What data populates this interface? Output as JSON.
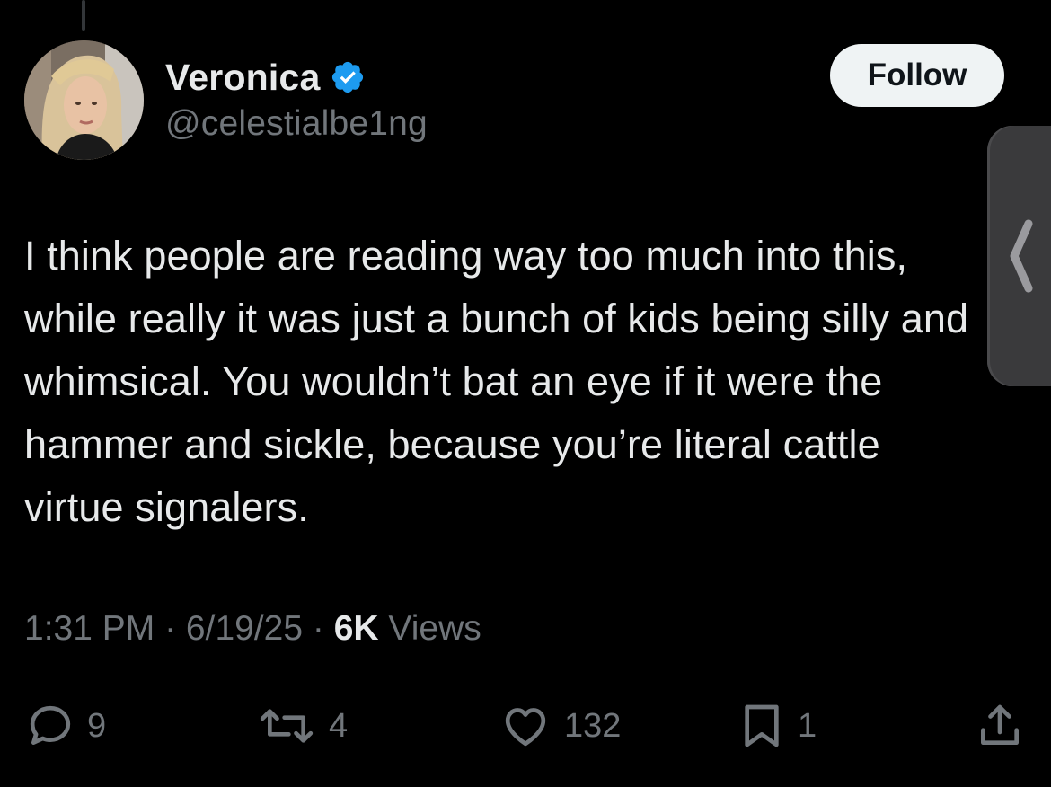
{
  "author": {
    "display_name": "Veronica",
    "handle": "@celestialbe1ng",
    "verified": true
  },
  "follow_button": {
    "label": "Follow"
  },
  "tweet": {
    "text": "I think people are reading way too much into this, while really it was just a bunch of kids being silly and whimsical. You wouldn’t bat an eye if it were the hammer and sickle, because you’re literal cattle virtue signalers.",
    "time": "1:31 PM",
    "date": "6/19/25",
    "separator": " · ",
    "views_count": "6K",
    "views_label": " Views"
  },
  "actions": {
    "replies": "9",
    "reposts": "4",
    "likes": "132",
    "bookmarks": "1"
  },
  "icons": {
    "reply": "reply-icon",
    "repost": "repost-icon",
    "like": "heart-icon",
    "bookmark": "bookmark-icon",
    "share": "share-icon",
    "verified": "verified-badge-icon",
    "side_tab": "chevron-left-icon"
  },
  "colors": {
    "background": "#000000",
    "text_primary": "#e7e9ea",
    "text_secondary": "#71767b",
    "verified_blue": "#1d9bf0",
    "follow_bg": "#eff3f4"
  }
}
